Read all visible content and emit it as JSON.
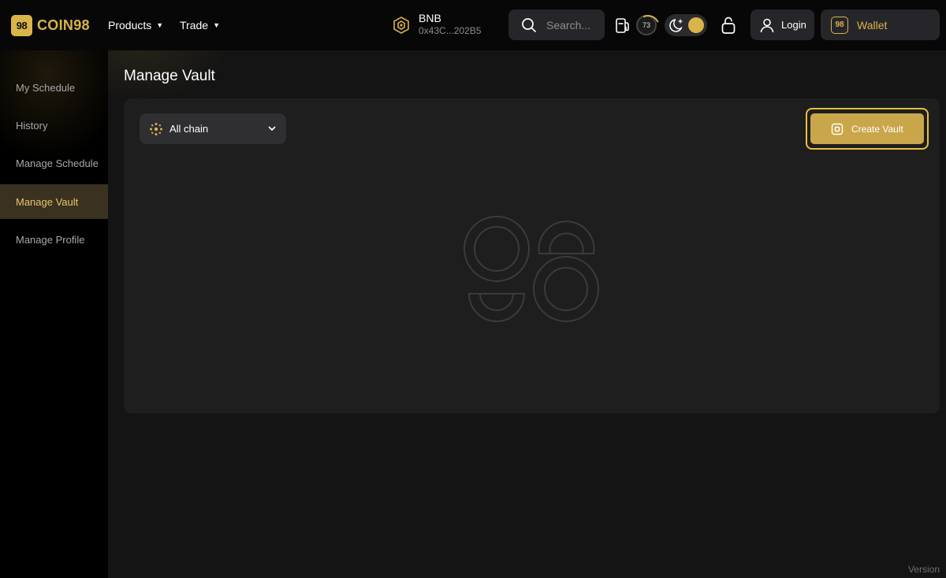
{
  "header": {
    "logo_mark": "98",
    "logo_text": "COIN98",
    "nav": [
      {
        "label": "Products"
      },
      {
        "label": "Trade"
      }
    ],
    "network": {
      "name": "BNB",
      "address": "0x43C...202B5"
    },
    "search": {
      "placeholder": "Search..."
    },
    "counter": "73",
    "login_label": "Login",
    "wallet_mark": "98",
    "wallet_label": "Wallet"
  },
  "sidebar": {
    "items": [
      {
        "label": "My Schedule",
        "active": false
      },
      {
        "label": "History",
        "active": false
      },
      {
        "label": "Manage Schedule",
        "active": false
      },
      {
        "label": "Manage Vault",
        "active": true
      },
      {
        "label": "Manage Profile",
        "active": false
      }
    ]
  },
  "main": {
    "title": "Manage Vault",
    "chain_select": {
      "value": "All chain"
    },
    "create_vault_label": "Create Vault"
  },
  "footer": {
    "version_label": "Version"
  },
  "colors": {
    "accent": "#d9b44a",
    "background": "#141414",
    "card": "#1e1e1f",
    "sidebar": "#000000"
  }
}
